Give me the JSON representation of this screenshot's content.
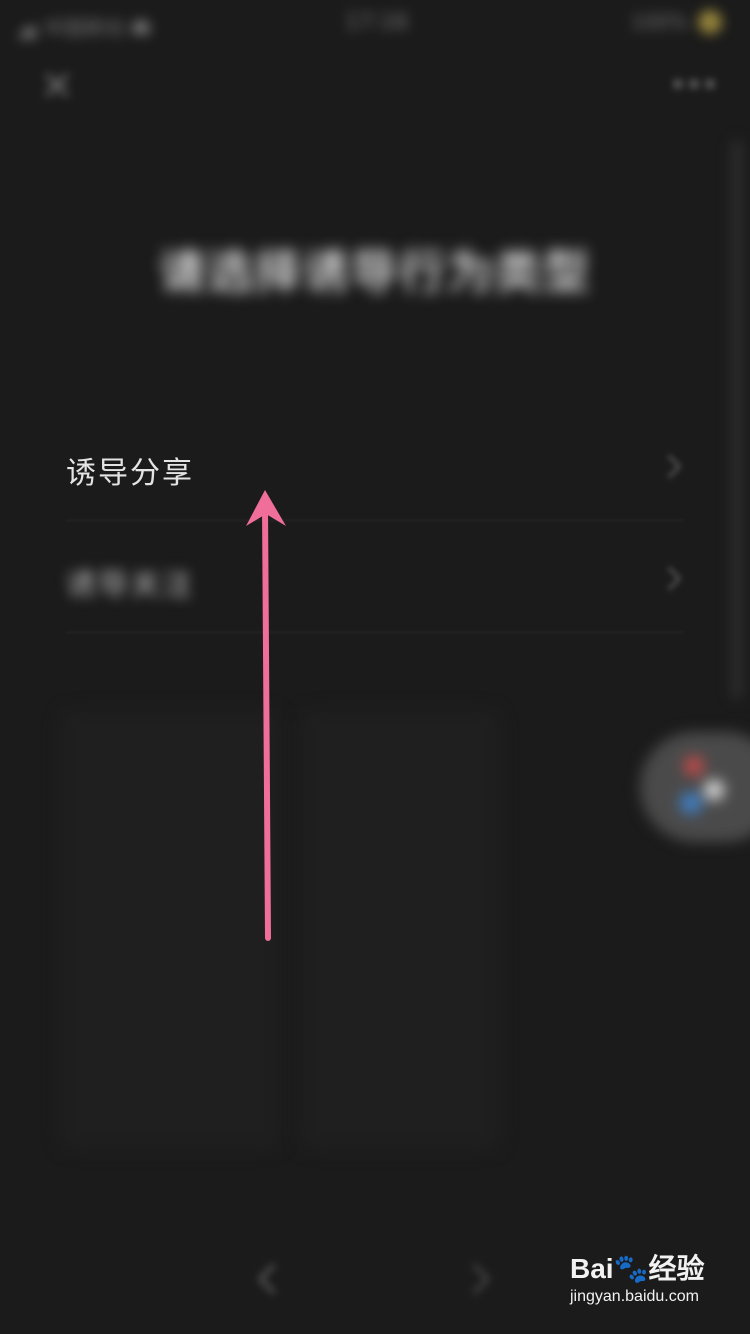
{
  "status_bar": {
    "carrier": "中国移动",
    "time": "17:16",
    "battery": "100%"
  },
  "nav": {
    "close_icon": "close-icon",
    "more_icon": "more-icon"
  },
  "page": {
    "title": "请选择诱导行为类型"
  },
  "options": [
    {
      "label": "诱导分享",
      "icon": "chevron-right-icon"
    },
    {
      "label": "诱导关注",
      "icon": "chevron-right-icon"
    }
  ],
  "annotation": {
    "arrow_color": "#f06f9a"
  },
  "watermark": {
    "brand": "Bai",
    "brand_suffix": "经验",
    "url": "jingyan.baidu.com"
  },
  "colors": {
    "background": "#1b1b1b",
    "text": "#e4e4e4"
  }
}
